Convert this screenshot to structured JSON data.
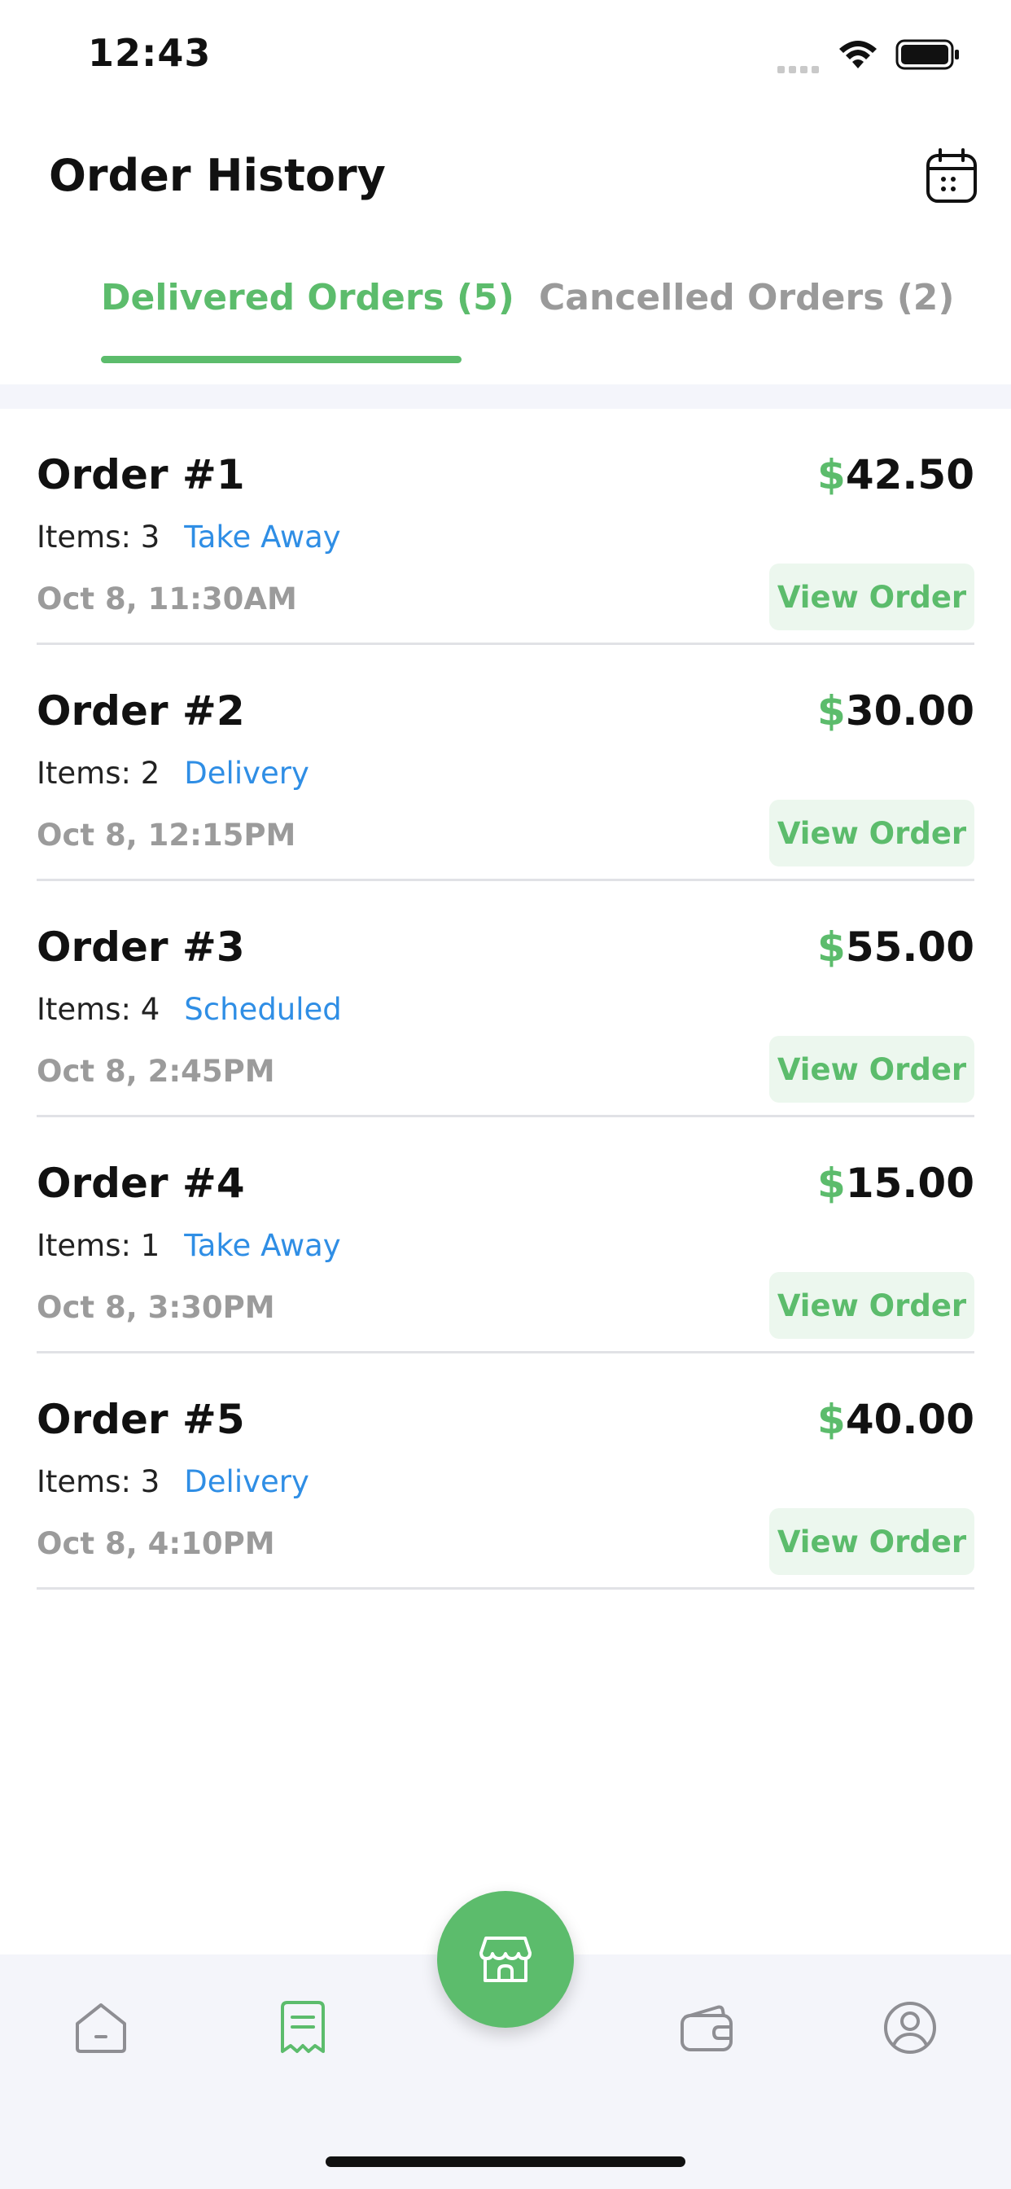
{
  "status": {
    "time": "12:43"
  },
  "header": {
    "title": "Order History",
    "calendar_icon": "calendar-icon"
  },
  "tabs": [
    {
      "label": "Delivered Orders (5)",
      "active": true
    },
    {
      "label": "Cancelled Orders (2)",
      "active": false
    }
  ],
  "orders": [
    {
      "title": "Order #1",
      "currency": "$",
      "amount": "42.50",
      "items": "Items: 3",
      "type": "Take Away",
      "date": "Oct 8, 11:30AM",
      "action": "View Order"
    },
    {
      "title": "Order #2",
      "currency": "$",
      "amount": "30.00",
      "items": "Items: 2",
      "type": "Delivery",
      "date": "Oct 8, 12:15PM",
      "action": "View Order"
    },
    {
      "title": "Order #3",
      "currency": "$",
      "amount": "55.00",
      "items": "Items: 4",
      "type": "Scheduled",
      "date": "Oct 8, 2:45PM",
      "action": "View Order"
    },
    {
      "title": "Order #4",
      "currency": "$",
      "amount": "15.00",
      "items": "Items: 1",
      "type": "Take Away",
      "date": "Oct 8, 3:30PM",
      "action": "View Order"
    },
    {
      "title": "Order #5",
      "currency": "$",
      "amount": "40.00",
      "items": "Items: 3",
      "type": "Delivery",
      "date": "Oct 8, 4:10PM",
      "action": "View Order"
    }
  ],
  "nav": {
    "items": [
      "home-icon",
      "receipt-icon",
      "store-icon",
      "wallet-icon",
      "profile-icon"
    ],
    "active": "receipt-icon"
  },
  "colors": {
    "accent": "#5cbc6c",
    "link": "#2f8ee5",
    "muted": "#9b9b9b",
    "button_bg": "#ecf7ee",
    "bar_bg": "#f4f5fa"
  }
}
